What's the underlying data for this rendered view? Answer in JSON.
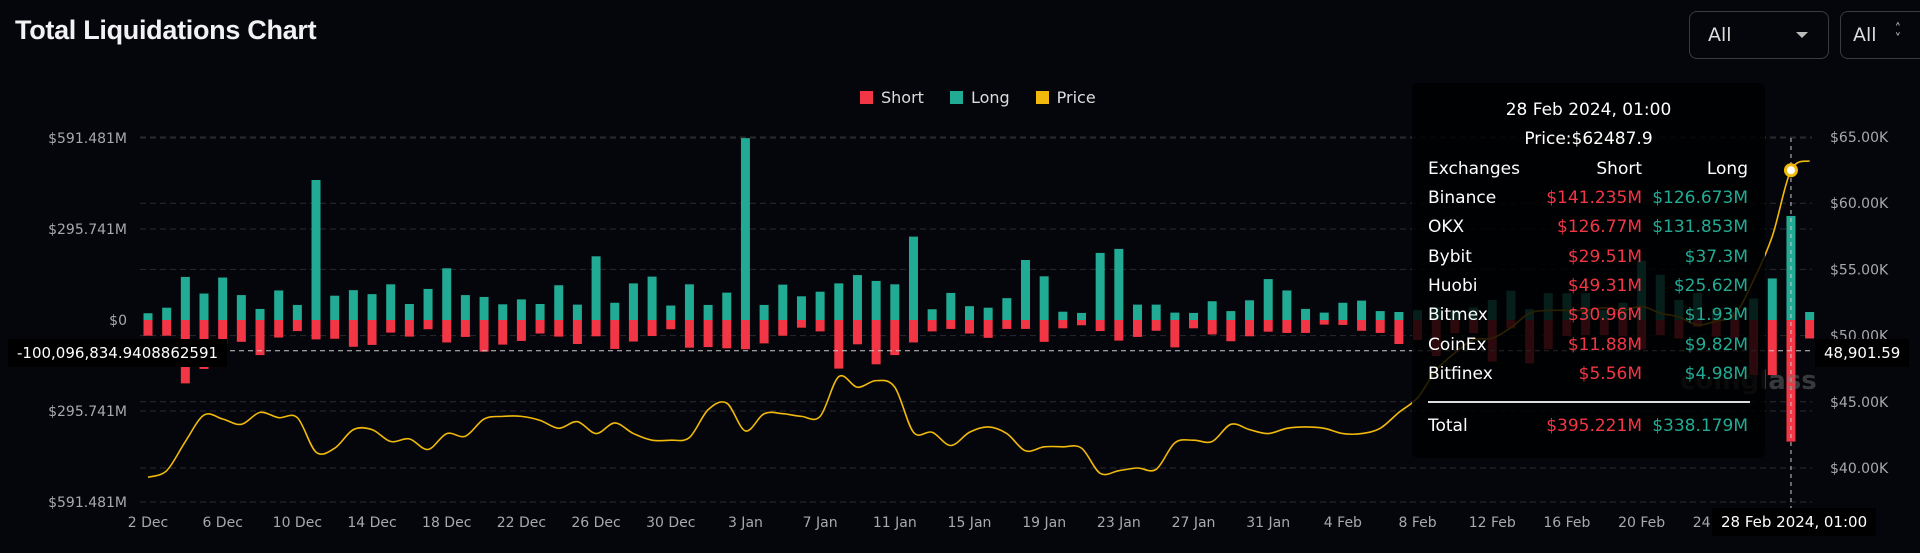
{
  "header": {
    "title": "Total Liquidations Chart"
  },
  "filters": [
    {
      "value": "All",
      "icon": "caret-down-icon"
    },
    {
      "value": "All",
      "icon": "chevron-up-down-icon"
    }
  ],
  "legend": [
    {
      "label": "Short",
      "color": "#f23645"
    },
    {
      "label": "Long",
      "color": "#22ab94"
    },
    {
      "label": "Price",
      "color": "#f0b90b"
    }
  ],
  "crosshair": {
    "left_value": "-100,096,834.9408862591",
    "right_value": "48,901.59",
    "x_value": "28 Feb 2024, 01:00"
  },
  "tooltip": {
    "title": "28 Feb 2024, 01:00",
    "price": "Price:$62487.9",
    "headers": [
      "Exchanges",
      "Short",
      "Long"
    ],
    "rows": [
      {
        "exchange": "Binance",
        "short": "$141.235M",
        "long": "$126.673M"
      },
      {
        "exchange": "OKX",
        "short": "$126.77M",
        "long": "$131.853M"
      },
      {
        "exchange": "Bybit",
        "short": "$29.51M",
        "long": "$37.3M"
      },
      {
        "exchange": "Huobi",
        "short": "$49.31M",
        "long": "$25.62M"
      },
      {
        "exchange": "Bitmex",
        "short": "$30.96M",
        "long": "$1.93M"
      },
      {
        "exchange": "CoinEx",
        "short": "$11.88M",
        "long": "$9.82M"
      },
      {
        "exchange": "Bitfinex",
        "short": "$5.56M",
        "long": "$4.98M"
      }
    ],
    "total": {
      "label": "Total",
      "short": "$395.221M",
      "long": "$338.179M"
    }
  },
  "watermark": "coinglass",
  "chart_data": {
    "type": "bar",
    "title": "Total Liquidations Chart",
    "categories": [
      "2 Dec",
      "3 Dec",
      "4 Dec",
      "5 Dec",
      "6 Dec",
      "7 Dec",
      "8 Dec",
      "9 Dec",
      "10 Dec",
      "11 Dec",
      "12 Dec",
      "13 Dec",
      "14 Dec",
      "15 Dec",
      "16 Dec",
      "17 Dec",
      "18 Dec",
      "19 Dec",
      "20 Dec",
      "21 Dec",
      "22 Dec",
      "23 Dec",
      "24 Dec",
      "25 Dec",
      "26 Dec",
      "27 Dec",
      "28 Dec",
      "29 Dec",
      "30 Dec",
      "31 Dec",
      "1 Jan",
      "2 Jan",
      "3 Jan",
      "4 Jan",
      "5 Jan",
      "6 Jan",
      "7 Jan",
      "8 Jan",
      "9 Jan",
      "10 Jan",
      "11 Jan",
      "12 Jan",
      "13 Jan",
      "14 Jan",
      "15 Jan",
      "16 Jan",
      "17 Jan",
      "18 Jan",
      "19 Jan",
      "20 Jan",
      "21 Jan",
      "22 Jan",
      "23 Jan",
      "24 Jan",
      "25 Jan",
      "26 Jan",
      "27 Jan",
      "28 Jan",
      "29 Jan",
      "30 Jan",
      "31 Jan",
      "1 Feb",
      "2 Feb",
      "3 Feb",
      "4 Feb",
      "5 Feb",
      "6 Feb",
      "7 Feb",
      "8 Feb",
      "9 Feb",
      "10 Feb",
      "11 Feb",
      "12 Feb",
      "13 Feb",
      "14 Feb",
      "15 Feb",
      "16 Feb",
      "17 Feb",
      "18 Feb",
      "19 Feb",
      "20 Feb",
      "21 Feb",
      "22 Feb",
      "23 Feb",
      "24 Feb",
      "25 Feb",
      "26 Feb",
      "27 Feb",
      "28 Feb",
      "29 Feb"
    ],
    "series": [
      {
        "name": "Long",
        "axis": "left",
        "color": "#22ab94",
        "unit": "$M",
        "values": [
          22,
          40,
          140,
          86,
          138,
          81,
          36,
          96,
          49,
          455,
          79,
          97,
          84,
          116,
          52,
          101,
          168,
          81,
          75,
          51,
          67,
          52,
          113,
          50,
          207,
          56,
          119,
          141,
          47,
          116,
          49,
          89,
          591,
          49,
          115,
          77,
          92,
          119,
          146,
          127,
          116,
          271,
          35,
          88,
          45,
          40,
          71,
          195,
          142,
          27,
          23,
          218,
          231,
          50,
          50,
          24,
          23,
          61,
          29,
          64,
          133,
          96,
          36,
          24,
          56,
          63,
          29,
          26,
          32,
          41,
          32,
          41,
          65,
          95,
          35,
          87,
          87,
          87,
          32,
          56,
          193,
          147,
          65,
          87,
          35,
          27,
          70,
          135,
          338.179,
          26
        ]
      },
      {
        "name": "Short",
        "axis": "left",
        "color": "#f23645",
        "unit": "$M",
        "direction": "down",
        "values": [
          51,
          51,
          206,
          159,
          76,
          71,
          114,
          57,
          36,
          63,
          61,
          87,
          81,
          41,
          54,
          30,
          73,
          55,
          103,
          80,
          68,
          44,
          54,
          78,
          53,
          94,
          70,
          52,
          30,
          90,
          88,
          92,
          95,
          76,
          51,
          25,
          37,
          158,
          79,
          144,
          114,
          73,
          37,
          29,
          44,
          58,
          29,
          29,
          71,
          27,
          17,
          36,
          67,
          55,
          35,
          89,
          27,
          47,
          69,
          53,
          38,
          42,
          42,
          15,
          16,
          35,
          42,
          78,
          65,
          117,
          43,
          43,
          135,
          27,
          141,
          95,
          52,
          49,
          49,
          52,
          95,
          49,
          60,
          22,
          54,
          60,
          179,
          179,
          395.221,
          60
        ]
      },
      {
        "name": "Price",
        "type": "line",
        "axis": "right",
        "color": "#f0b90b",
        "unit": "$",
        "values": [
          39300,
          39800,
          42000,
          44000,
          43700,
          43300,
          44200,
          43800,
          43800,
          41200,
          41500,
          42900,
          42900,
          42000,
          42200,
          41400,
          42600,
          42400,
          43700,
          43900,
          43900,
          43600,
          43000,
          43500,
          42600,
          43400,
          42600,
          42100,
          42100,
          42300,
          44400,
          44900,
          42800,
          44100,
          44100,
          43900,
          43900,
          46900,
          46100,
          46600,
          46100,
          42700,
          42700,
          41700,
          42700,
          43100,
          42600,
          41300,
          41600,
          41600,
          41500,
          39600,
          39800,
          40000,
          39900,
          41900,
          42100,
          42000,
          43300,
          42900,
          42600,
          43000,
          43100,
          43000,
          42600,
          42600,
          43000,
          44200,
          45300,
          47400,
          48700,
          49700,
          49800,
          50600,
          51700,
          51900,
          51900,
          51900,
          52100,
          51900,
          52200,
          51700,
          51400,
          50800,
          51100,
          51600,
          54200,
          57500,
          62487.9,
          63200
        ]
      }
    ],
    "x_ticks": [
      "2 Dec",
      "6 Dec",
      "10 Dec",
      "14 Dec",
      "18 Dec",
      "22 Dec",
      "26 Dec",
      "30 Dec",
      "3 Jan",
      "7 Jan",
      "11 Jan",
      "15 Jan",
      "19 Jan",
      "23 Jan",
      "27 Jan",
      "31 Jan",
      "4 Feb",
      "8 Feb",
      "12 Feb",
      "16 Feb",
      "20 Feb",
      "24 Feb"
    ],
    "left_axis": {
      "range": [
        -591.481,
        591.481
      ],
      "ticks": [
        {
          "value": 591.481,
          "label": "$591.481M"
        },
        {
          "value": 295.741,
          "label": "$295.741M"
        },
        {
          "value": 0,
          "label": "$0"
        },
        {
          "value": -295.741,
          "label": "$295.741M"
        },
        {
          "value": -591.481,
          "label": "$591.481M"
        }
      ]
    },
    "right_axis": {
      "range": [
        40000,
        65000
      ],
      "ticks": [
        {
          "value": 65000,
          "label": "$65.00K"
        },
        {
          "value": 60000,
          "label": "$60.00K"
        },
        {
          "value": 55000,
          "label": "$55.00K"
        },
        {
          "value": 50000,
          "label": "$50.00K"
        },
        {
          "value": 45000,
          "label": "$45.00K"
        },
        {
          "value": 40000,
          "label": "$40.00K"
        }
      ]
    },
    "grid": true,
    "legend_position": "top-center",
    "highlight": {
      "category": "28 Feb",
      "crosshair_left_value": -100096834.94088626,
      "crosshair_price": 48901.59
    }
  }
}
